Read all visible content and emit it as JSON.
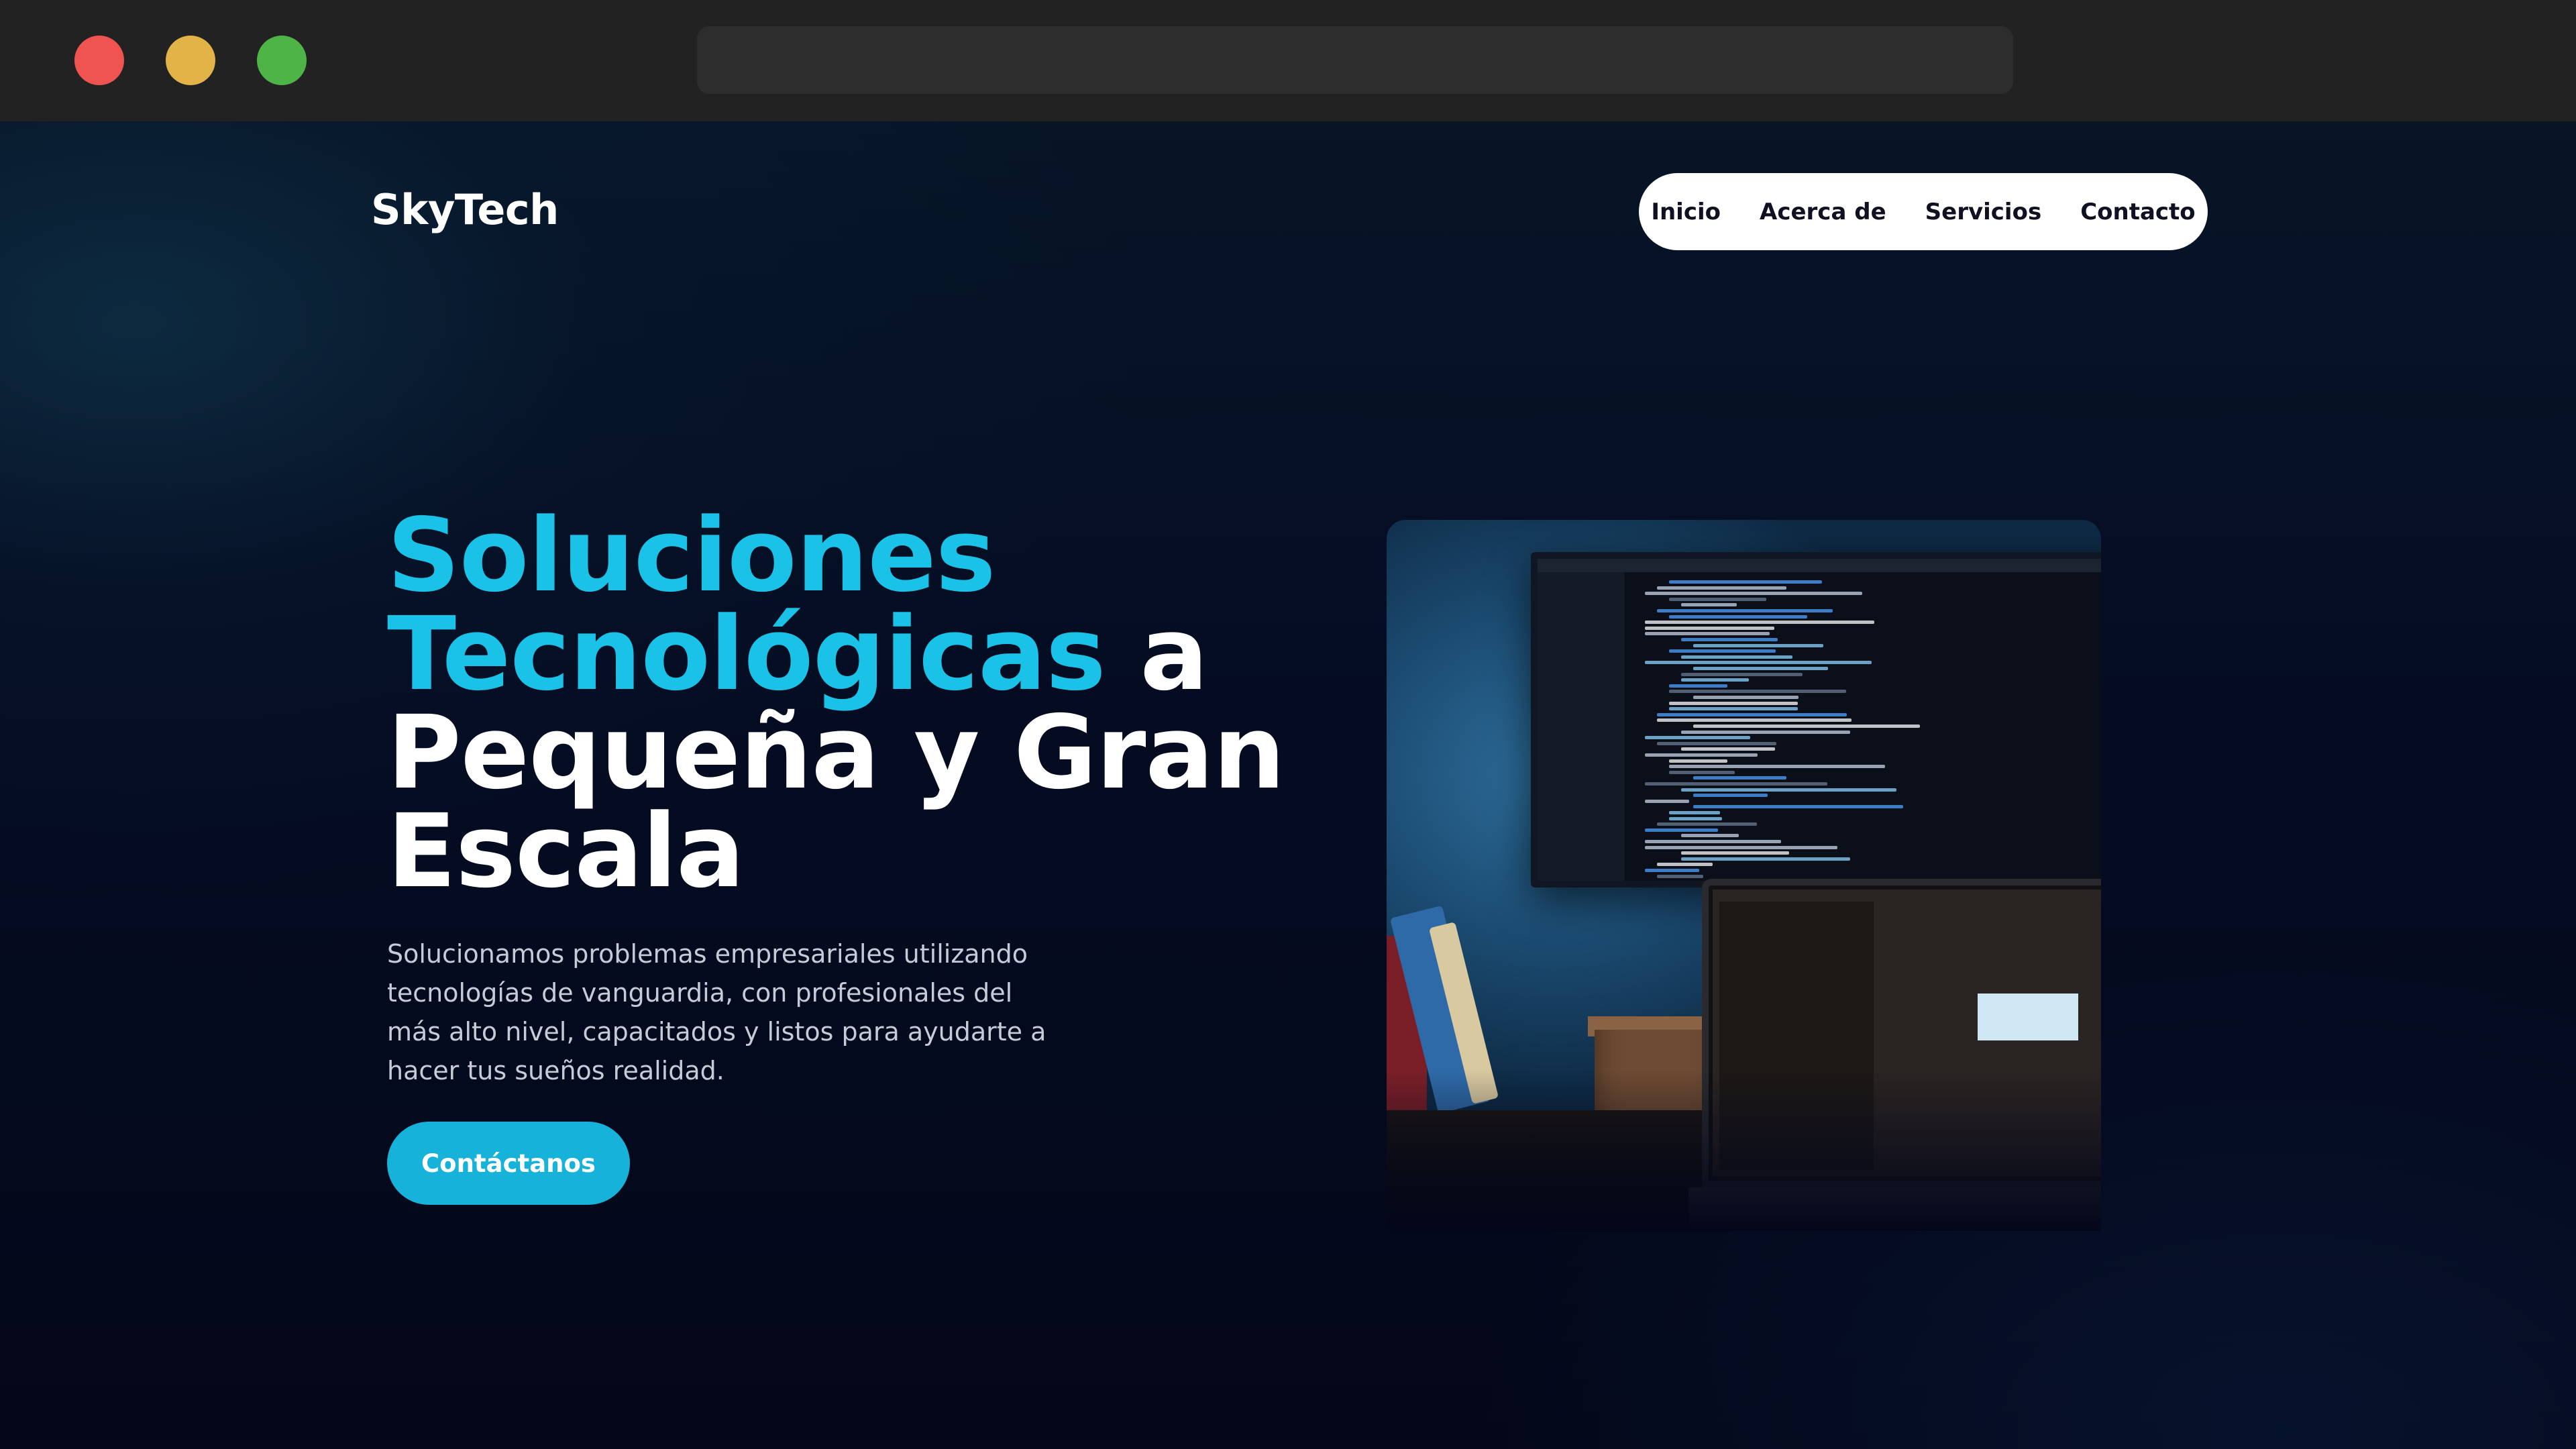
{
  "browser": {
    "window_controls": [
      "close",
      "minimize",
      "maximize"
    ],
    "address": ""
  },
  "brand": {
    "name": "SkyTech"
  },
  "nav": {
    "items": [
      "Inicio",
      "Acerca de",
      "Servicios",
      "Contacto"
    ]
  },
  "hero": {
    "title_accent_1": "Soluciones",
    "title_accent_2": "Tecnológicas",
    "title_rest_1": "a",
    "title_rest_2": "Pequeña y Gran",
    "title_rest_3": "Escala",
    "description": "Solucionamos problemas empresariales utilizando tecnologías de vanguardia, con profesionales del más alto nivel, capacitados y listos para ayudarte a hacer tus sueños realidad.",
    "cta_label": "Contáctanos",
    "image": "developer-workspace-monitor-laptop"
  },
  "colors": {
    "accent": "#19c2e6",
    "cta": "#17b2da",
    "background": "#04071a",
    "nav_background": "#ffffff"
  }
}
